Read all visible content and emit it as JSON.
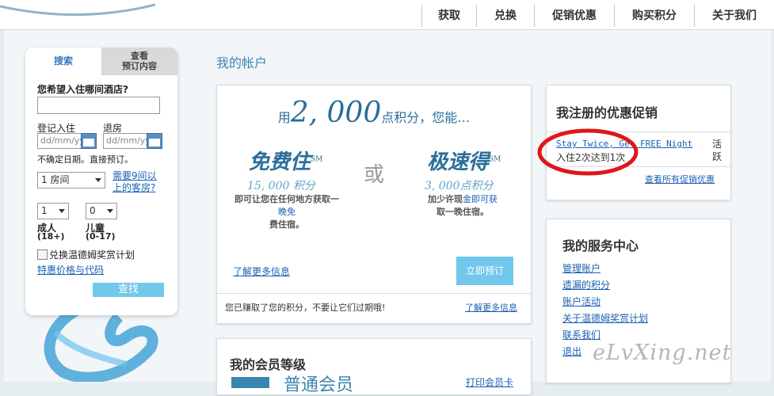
{
  "nav": [
    "获取",
    "兑换",
    "促销优惠",
    "购买积分",
    "关于我们"
  ],
  "search": {
    "tab_search": "搜索",
    "tab_view_line1": "查看",
    "tab_view_line2": "预订内容",
    "where_label": "您希望入住哪间酒店?",
    "checkin_label": "登记入住",
    "checkout_label": "退房",
    "date_placeholder": "dd/mm/yy",
    "unsure_text": "不确定日期。直接预订。",
    "rooms_value": "1 房间",
    "more_rooms_link_line1": "需要9间以",
    "more_rooms_link_line2": "上的客房?",
    "adults_value": "1",
    "children_value": "0",
    "adults_label": "成人",
    "adults_range": "(18+)",
    "children_label": "儿童",
    "children_range": "(0-17)",
    "redeem_label": "兑换温德姆奖赏计划",
    "special_rates_link": "特惠价格与代码",
    "find_button": "查找"
  },
  "main": {
    "section_title": "我的帐户",
    "promo": {
      "prefix": "用",
      "points": "2, 000",
      "suffix": "点积分，您能…",
      "option1_title": "免费住",
      "option1_mark": "SM",
      "option1_points": "15, 000 积分",
      "option1_desc_line1": "即可让您在任何地方获取一",
      "option1_desc_link": "晚免",
      "option1_desc_line3": "费住宿。",
      "or_text": "或",
      "option2_title": "极速得",
      "option2_mark": "SM",
      "option2_points": "3, 000点积分",
      "option2_desc_pre": "加少许现",
      "option2_desc_link": "金即可获",
      "option2_desc_line2": "取一晚住宿。",
      "learn_more": "了解更多信息",
      "book_now": "立即预订",
      "footer_text": "您已赚取了您的积分，不要让它们过期哦!",
      "footer_link": "了解更多信息"
    },
    "membership": {
      "title": "我的会员等级",
      "level_partial": "普通会员",
      "print_link_partial": "打印会员卡"
    }
  },
  "promotions": {
    "title": "我注册的优惠促销",
    "item_link": "Stay Twice, Get   FREE Night",
    "item_status": "活跃",
    "item_progress": "入住2次达到1次",
    "view_all": "查看所有促销优惠"
  },
  "service": {
    "title": "我的服务中心",
    "links": [
      "管理账户",
      "遗漏的积分",
      "账户活动",
      "关于温德姆奖赏计划",
      "联系我们",
      "退出"
    ]
  },
  "watermark": "eLvXing.net",
  "colors": {
    "accent": "#72c7ec",
    "link": "#1a5fb4",
    "title_blue": "#2a6e9a",
    "annotation_red": "#e0161b"
  }
}
